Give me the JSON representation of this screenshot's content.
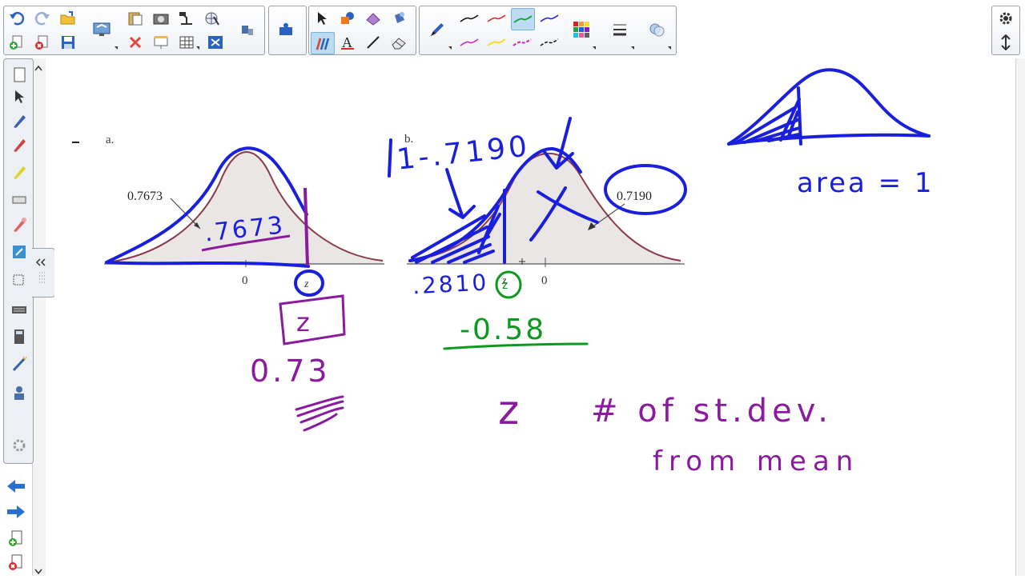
{
  "toolbar": {
    "groups": [
      {
        "name": "file-edit",
        "items": [
          "undo",
          "redo",
          "open",
          "add-page",
          "delete-page",
          "save",
          "screen-shade",
          "clear",
          "paste",
          "screen-capture",
          "document-camera",
          "table",
          "properties",
          "gallery-tools"
        ]
      },
      {
        "name": "pen-tools",
        "items": [
          "select",
          "shapes",
          "fill",
          "magic-pen",
          "eraser",
          "text",
          "line",
          "creative-pen"
        ]
      },
      {
        "name": "pen-styles",
        "items": [
          "pen-black",
          "pen-red",
          "pen-green",
          "pen-blue",
          "pen-magenta",
          "pen-yellow",
          "pen-magenta-dash",
          "pen-black-dash",
          "color-palette",
          "line-style",
          "fill-effects"
        ]
      }
    ],
    "right": [
      "settings",
      "move-toolbar"
    ]
  },
  "sidebar": [
    "page-sorter",
    "gallery",
    "attachments",
    "properties",
    "add-ons",
    "smart-ink",
    "gallery-pen",
    "magic-pen",
    "notebook",
    "keyboard",
    "calculator",
    "magic-wand",
    "user",
    "settings"
  ],
  "nav": {
    "prev": "previous-page",
    "next": "next-page",
    "add": "add-page",
    "delete": "delete-page"
  },
  "colors": {
    "ink_blue": "#1a1fdc",
    "ink_purple": "#8a1a9e",
    "ink_green": "#0b9a1e",
    "curve": "#8a3a4a",
    "fill": "#ebe6e6",
    "accent": "#bcdcf2"
  },
  "content": {
    "fig_a": {
      "label": "a.",
      "area_label": "0.7673",
      "zero": "0",
      "z": "z",
      "ink_area": ".7673",
      "ink_z": "z",
      "ink_value": "0.73"
    },
    "fig_b": {
      "label": "b.",
      "area_label": "0.7190",
      "zero": "0",
      "z": "z",
      "ink_calc": "1-.7190",
      "ink_left_area": ".2810",
      "ink_z": "z",
      "ink_value": "-0.58"
    },
    "notes": {
      "area_text": "area = 1",
      "z_text": "z",
      "def_line1": "# of st.dev.",
      "def_line2": "from mean"
    }
  }
}
